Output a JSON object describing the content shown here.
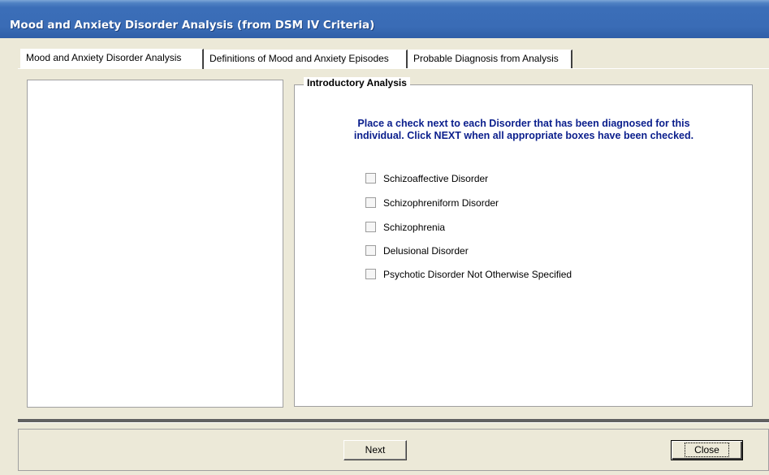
{
  "window": {
    "title": "Mood and Anxiety Disorder Analysis (from DSM IV Criteria)"
  },
  "tabs": [
    {
      "label": "Mood and Anxiety Disorder Analysis",
      "selected": true
    },
    {
      "label": "Definitions of Mood and Anxiety Episodes",
      "selected": false
    },
    {
      "label": "Probable Diagnosis from Analysis",
      "selected": false
    }
  ],
  "group": {
    "title": "Introductory Analysis",
    "instructions_line1": "Place a check next to each Disorder that has been diagnosed for this",
    "instructions_line2": "individual.  Click NEXT when all appropriate boxes have been checked."
  },
  "disorders": [
    {
      "label": "Schizoaffective Disorder",
      "checked": false
    },
    {
      "label": "Schizophreniform Disorder",
      "checked": false
    },
    {
      "label": "Schizophrenia",
      "checked": false
    },
    {
      "label": "Delusional Disorder",
      "checked": false
    },
    {
      "label": "Psychotic Disorder Not Otherwise Specified",
      "checked": false
    }
  ],
  "buttons": {
    "next": "Next",
    "close": "Close"
  }
}
